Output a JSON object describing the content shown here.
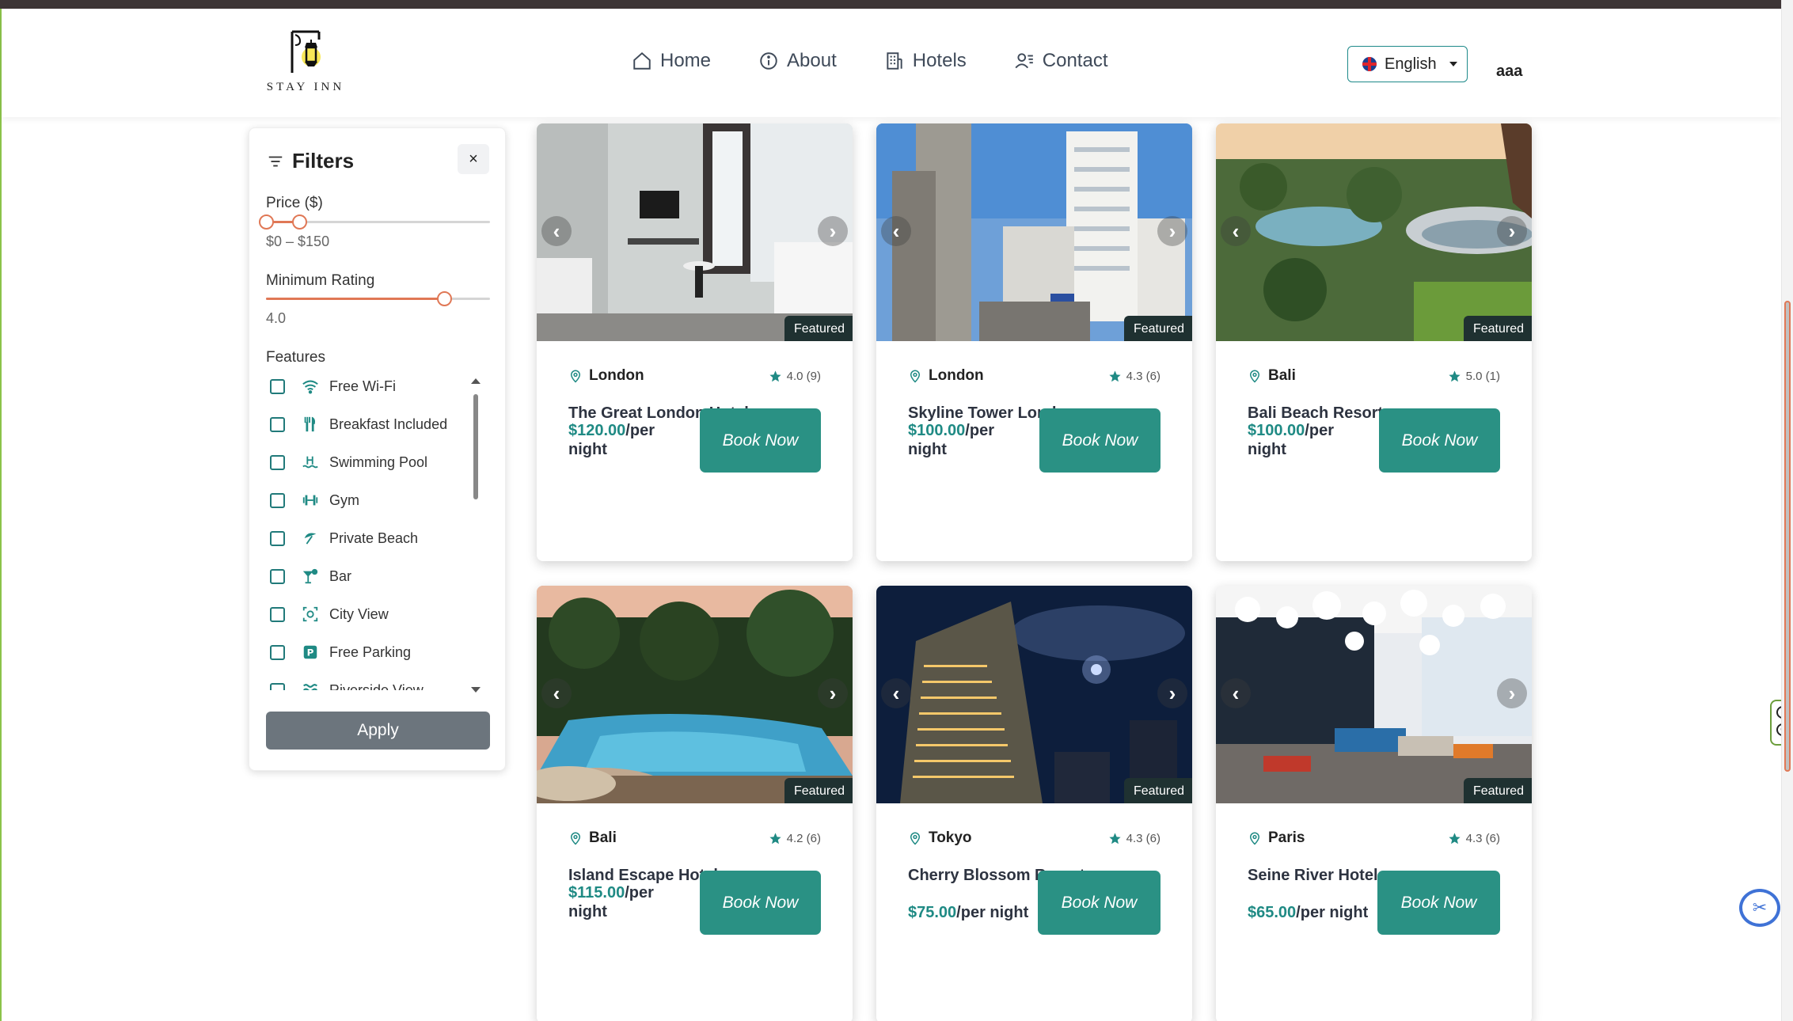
{
  "header": {
    "logo_text": "STAY INN",
    "nav": [
      {
        "label": "Home",
        "icon": "home-icon"
      },
      {
        "label": "About",
        "icon": "info-icon"
      },
      {
        "label": "Hotels",
        "icon": "building-icon"
      },
      {
        "label": "Contact",
        "icon": "contact-icon"
      }
    ],
    "language": "English",
    "user": "aaa"
  },
  "filters": {
    "title": "Filters",
    "close_label": "×",
    "price_label": "Price ($)",
    "price_range": [
      0,
      150
    ],
    "price_value": "$0 – $150",
    "rating_label": "Minimum Rating",
    "rating_value": "4.0",
    "rating_min": 4.0,
    "rating_max": 5.0,
    "features_label": "Features",
    "features": [
      {
        "label": "Free Wi-Fi",
        "icon": "wifi-icon",
        "checked": false
      },
      {
        "label": "Breakfast Included",
        "icon": "utensils-icon",
        "checked": false
      },
      {
        "label": "Swimming Pool",
        "icon": "pool-icon",
        "checked": false
      },
      {
        "label": "Gym",
        "icon": "dumbbell-icon",
        "checked": false
      },
      {
        "label": "Private Beach",
        "icon": "umbrella-beach-icon",
        "checked": false
      },
      {
        "label": "Bar",
        "icon": "cocktail-icon",
        "checked": false
      },
      {
        "label": "City View",
        "icon": "city-view-icon",
        "checked": false
      },
      {
        "label": "Free Parking",
        "icon": "parking-icon",
        "checked": false
      },
      {
        "label": "Riverside View",
        "icon": "water-icon",
        "checked": false
      }
    ],
    "apply_label": "Apply"
  },
  "hotels": [
    {
      "location": "London",
      "rating": "4.0 (9)",
      "name": "The Great London Hotel",
      "price": "$120.00",
      "per": "/per night",
      "badge": "Featured",
      "book": "Book Now"
    },
    {
      "location": "London",
      "rating": "4.3 (6)",
      "name": "Skyline Tower London",
      "price": "$100.00",
      "per": "/per night",
      "badge": "Featured",
      "book": "Book Now"
    },
    {
      "location": "Bali",
      "rating": "5.0 (1)",
      "name": "Bali Beach Resort",
      "price": "$100.00",
      "per": "/per night",
      "badge": "Featured",
      "book": "Book Now"
    },
    {
      "location": "Bali",
      "rating": "4.2 (6)",
      "name": "Island Escape Hotel",
      "price": "$115.00",
      "per": "/per night",
      "badge": "Featured",
      "book": "Book Now"
    },
    {
      "location": "Tokyo",
      "rating": "4.3 (6)",
      "name": "Cherry Blossom Resort",
      "price": "$75.00",
      "per": "/per night",
      "badge": "Featured",
      "book": "Book Now"
    },
    {
      "location": "Paris",
      "rating": "4.3 (6)",
      "name": "Seine River Hotel",
      "price": "$65.00",
      "per": "/per night",
      "badge": "Featured",
      "book": "Book Now"
    }
  ],
  "colors": {
    "accent": "#2a9184",
    "slider": "#e07856",
    "badge_bg": "#1f3131",
    "apply_bg": "#6c757d"
  }
}
